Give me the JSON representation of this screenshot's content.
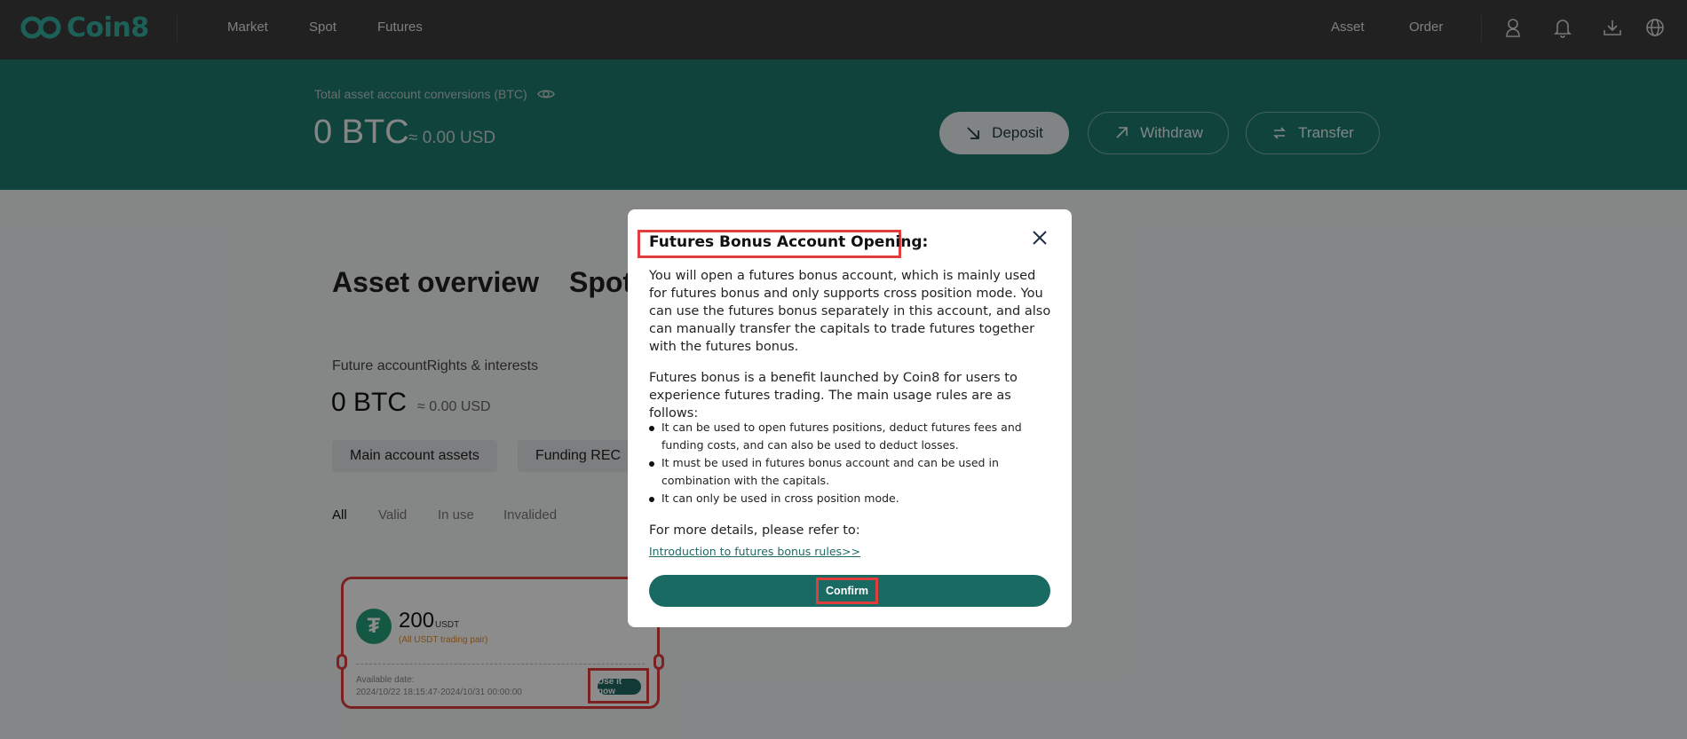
{
  "brand": {
    "name": "Coin8",
    "color": "#36b0a1"
  },
  "nav": {
    "items": [
      "Market",
      "Spot",
      "Futures"
    ],
    "right_items": [
      "Asset",
      "Order"
    ],
    "icons": [
      "user-icon",
      "bell-icon",
      "download-icon",
      "globe-icon"
    ]
  },
  "header": {
    "label": "Total asset account conversions (BTC)",
    "balance": "0 BTC",
    "balance_usd": "≈ 0.00 USD",
    "deposit": "Deposit",
    "withdraw": "Withdraw",
    "transfer": "Transfer",
    "bg_color": "#1f7a70"
  },
  "main": {
    "tabs": [
      "Asset overview",
      "Spot"
    ],
    "future_label": "Future accountRights & interests",
    "future_balance": "0 BTC",
    "future_usd": "≈ 0.00 USD",
    "pills": [
      "Main account assets",
      "Funding REC"
    ],
    "filters": [
      "All",
      "Valid",
      "In use",
      "Invalided"
    ]
  },
  "coupon": {
    "amount": "200",
    "unit": "USDT",
    "pair": "(All USDT trading pair)",
    "available_label": "Available date:",
    "dates": "2024/10/22 18:15:47-2024/10/31 00:00:00",
    "use_button": "Use it now"
  },
  "modal": {
    "title": "Futures Bonus Account Opening:",
    "paragraph1": "You will open a futures bonus account, which is mainly used for futures bonus and only supports cross position mode. You can use the futures bonus separately in this account, and also can manually transfer the capitals to trade futures together with the futures bonus.",
    "paragraph2": "Futures bonus is a benefit launched by Coin8 for users to experience futures trading. The main usage rules are as follows:",
    "rules": [
      "It can be used to open futures positions, deduct futures fees and funding costs, and can also be used to deduct losses.",
      "It must be used in futures bonus account and can be used in combination with the capitals.",
      "It can only be used in cross position mode."
    ],
    "more": "For more details, please refer to:",
    "link": "Introduction to futures bonus rules>>",
    "confirm": "Confirm",
    "accent_color": "#1a6a64",
    "highlight_color": "#e23d3d"
  }
}
